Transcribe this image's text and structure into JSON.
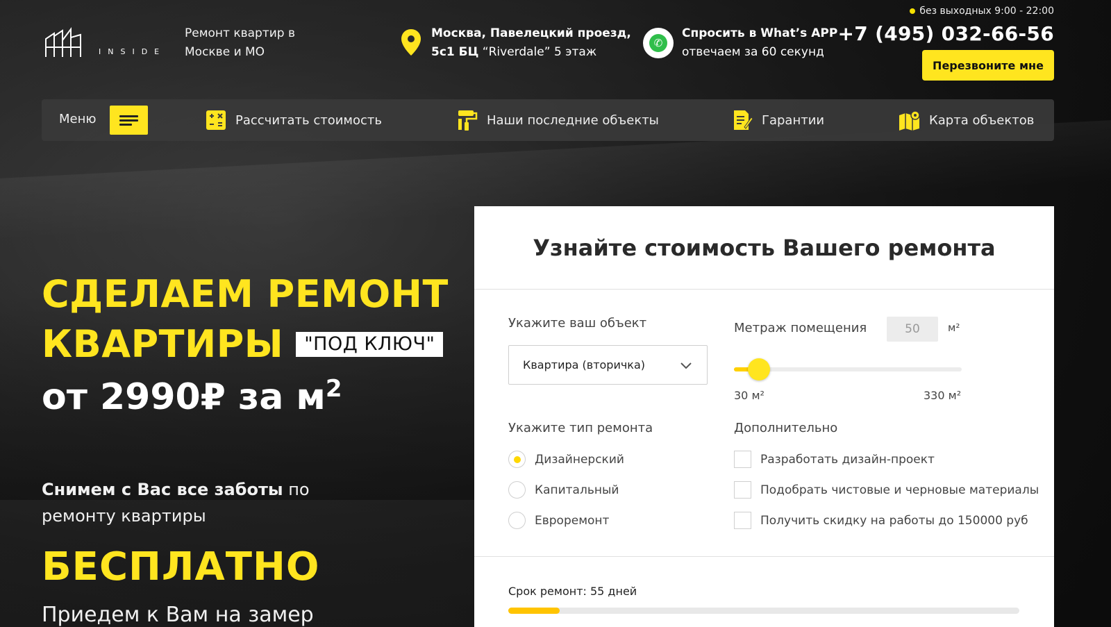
{
  "header": {
    "logo_text": "INSIDE",
    "tagline": "Ремонт квартир в Москве и МО",
    "address_line1": "Москва, Павелецкий проезд,",
    "address_line2_bold": "5с1 БЦ",
    "address_line2_rest": " “Riverdale” 5 этаж",
    "whatsapp_title": "Спросить в What’s APP",
    "whatsapp_sub": "отвечаем за 60 секунд",
    "hours": "без выходных 9:00 - 22:00",
    "phone": "+7 (495) 032-66-56",
    "callback_label": "Перезвоните мне"
  },
  "nav": {
    "menu_label": "Меню",
    "items": [
      {
        "label": "Рассчитать стоимость",
        "icon": "calculator-icon"
      },
      {
        "label": "Наши последние объекты",
        "icon": "paint-roller-icon"
      },
      {
        "label": "Гарантии",
        "icon": "document-pen-icon"
      },
      {
        "label": "Карта объектов",
        "icon": "map-icon"
      }
    ]
  },
  "hero": {
    "title_line1": "СДЕЛАЕМ РЕМОНТ",
    "title_line2": "КВАРТИРЫ",
    "badge": "\"ПОД КЛЮЧ\"",
    "price": "от 2990₽ за м",
    "price_sup": "2",
    "sub_bold": "Снимем с Вас все заботы",
    "sub_rest": " по ремонту квартиры",
    "free": "БЕСПЛАТНО",
    "measure": "Приедем к Вам на замер"
  },
  "calculator": {
    "title": "Узнайте стоимость Вашего ремонта",
    "object_label": "Укажите ваш объект",
    "object_value": "Квартира (вторичка)",
    "area_label": "Метраж помещения",
    "area_value": "50",
    "area_unit": "м²",
    "area_min": 30,
    "area_max": 330,
    "range_min_label": "30 м²",
    "range_max_label": "330 м²",
    "type_label": "Укажите тип ремонта",
    "types": [
      {
        "label": "Дизайнерский",
        "selected": true
      },
      {
        "label": "Капитальный",
        "selected": false
      },
      {
        "label": "Евроремонт",
        "selected": false
      }
    ],
    "extra_label": "Дополнительно",
    "extras": [
      {
        "label": "Разработать дизайн-проект",
        "checked": false
      },
      {
        "label": "Подобрать чистовые и черновые материалы",
        "checked": false
      },
      {
        "label": "Получить скидку на работы до 150000 руб",
        "checked": false
      }
    ],
    "term_label": "Срок ремонт: 55 дней",
    "term_progress": 0.1
  },
  "colors": {
    "accent": "#ffe51f",
    "dark": "#1e1e1e"
  }
}
